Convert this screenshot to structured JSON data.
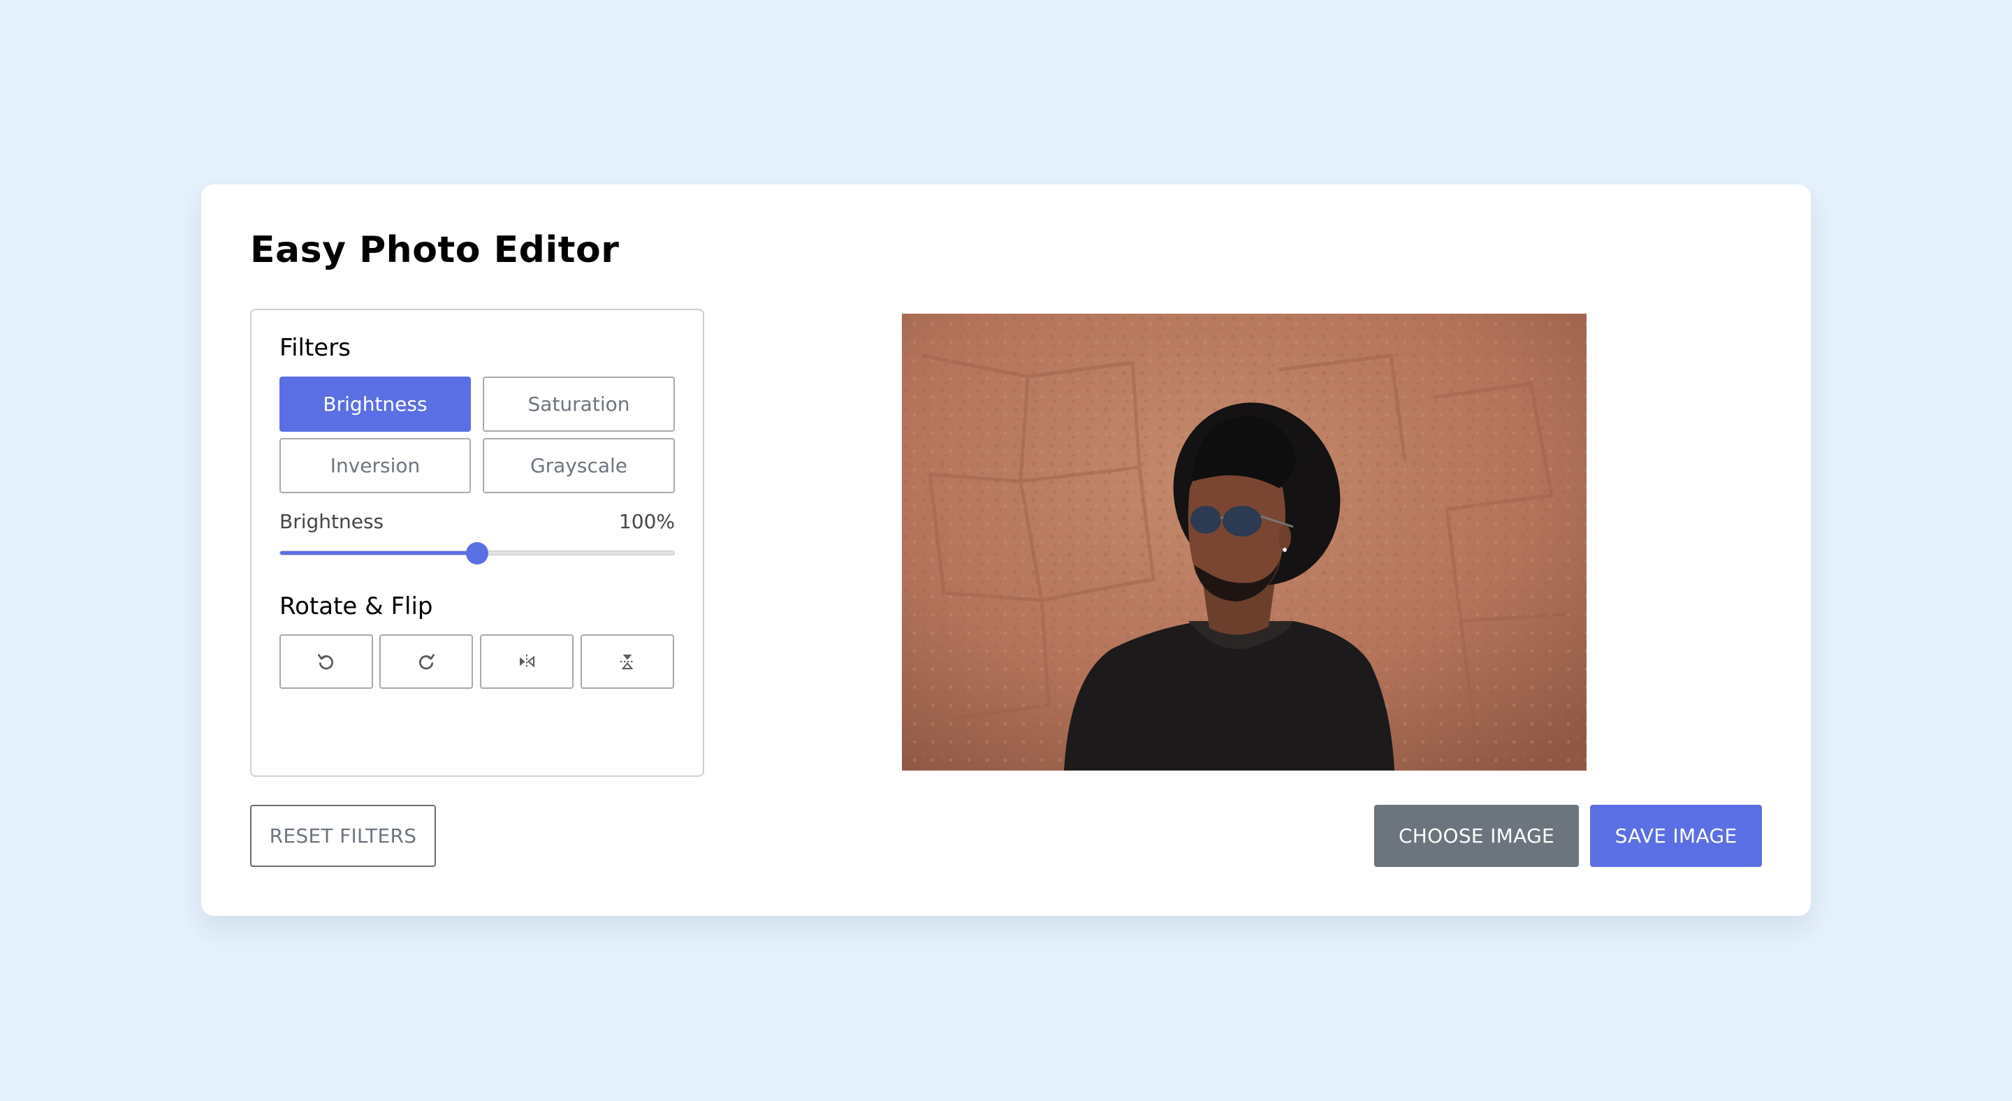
{
  "app": {
    "title": "Easy Photo Editor"
  },
  "filters": {
    "heading": "Filters",
    "buttons": [
      {
        "label": "Brightness",
        "active": true
      },
      {
        "label": "Saturation",
        "active": false
      },
      {
        "label": "Inversion",
        "active": false
      },
      {
        "label": "Grayscale",
        "active": false
      }
    ],
    "slider": {
      "name": "Brightness",
      "value_text": "100%",
      "fraction": 0.5
    }
  },
  "rotate_flip": {
    "heading": "Rotate & Flip",
    "buttons": [
      {
        "icon": "rotate-left-icon"
      },
      {
        "icon": "rotate-right-icon"
      },
      {
        "icon": "flip-horizontal-icon"
      },
      {
        "icon": "flip-vertical-icon"
      }
    ]
  },
  "preview": {
    "description_icon": "photo-preview"
  },
  "actions": {
    "reset": "RESET FILTERS",
    "choose": "CHOOSE IMAGE",
    "save": "SAVE IMAGE"
  },
  "colors": {
    "accent": "#5b6fe4",
    "secondary": "#6c757d",
    "background": "#e5f1fb"
  }
}
